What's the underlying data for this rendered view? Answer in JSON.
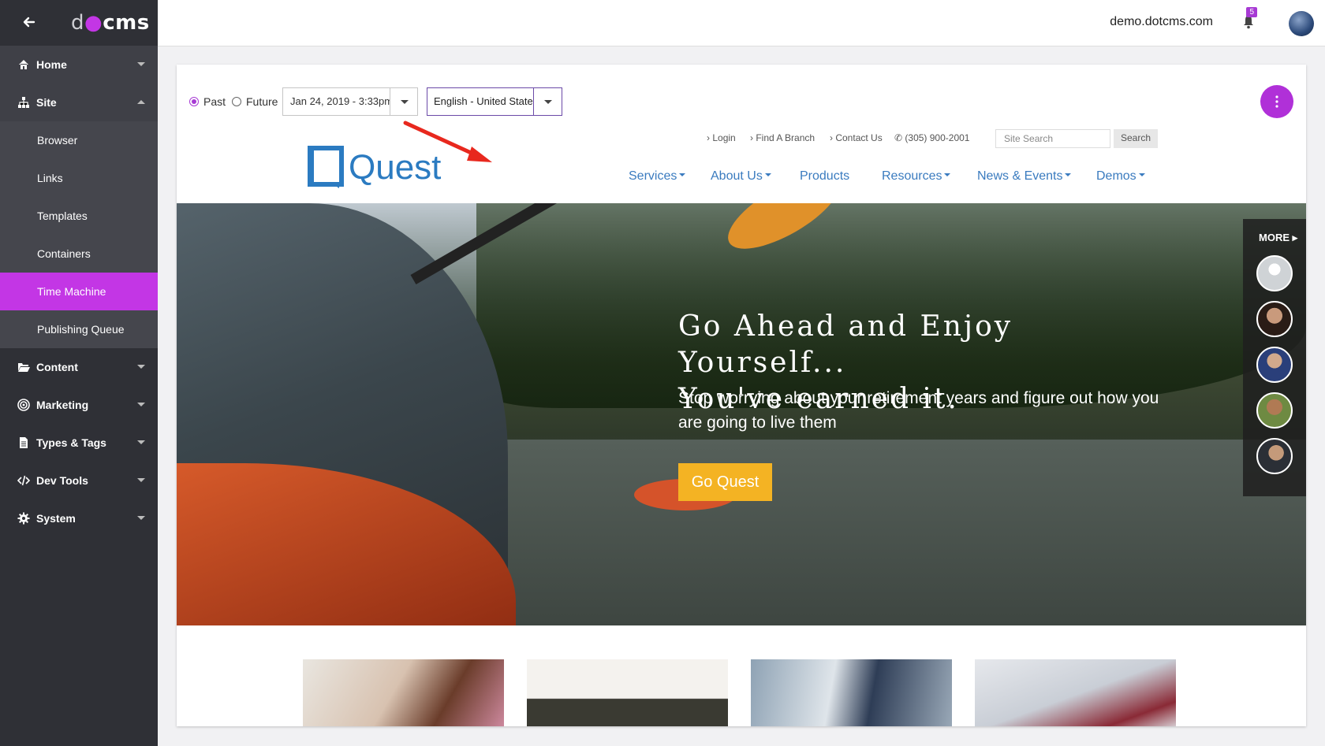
{
  "sidebar": {
    "logo": {
      "d": "d",
      "cms": "cms"
    },
    "items": [
      {
        "label": "Home"
      },
      {
        "label": "Site"
      },
      {
        "label": "Content"
      },
      {
        "label": "Marketing"
      },
      {
        "label": "Types & Tags"
      },
      {
        "label": "Dev Tools"
      },
      {
        "label": "System"
      }
    ],
    "site_subitems": [
      {
        "label": "Browser"
      },
      {
        "label": "Links"
      },
      {
        "label": "Templates"
      },
      {
        "label": "Containers"
      },
      {
        "label": "Time Machine"
      },
      {
        "label": "Publishing Queue"
      }
    ],
    "active_subitem": "Time Machine",
    "accent": "#c336e5"
  },
  "topbar": {
    "site": "demo.dotcms.com",
    "notifications": "5"
  },
  "toolbar": {
    "past_label": "Past",
    "future_label": "Future",
    "selected": "Past",
    "date_value": "Jan 24, 2019 -  3:33pm",
    "language_value": "English - United States"
  },
  "site_header": {
    "logo_text": "Quest",
    "util_links": [
      "Login",
      "Find A Branch",
      "Contact Us",
      "(305) 900-2001"
    ],
    "search_placeholder": "Site Search",
    "search_button": "Search",
    "menu": [
      "Services",
      "About Us",
      "Products",
      "Resources",
      "News & Events",
      "Demos"
    ]
  },
  "hero": {
    "title_line1": "Go Ahead and Enjoy Yourself...",
    "title_line2": "You've earned it.",
    "subtitle": "Stop worrying about your retirement years and figure out how you are going to live them",
    "cta": "Go Quest",
    "more_label": "MORE",
    "cta_color": "#f4b323"
  }
}
